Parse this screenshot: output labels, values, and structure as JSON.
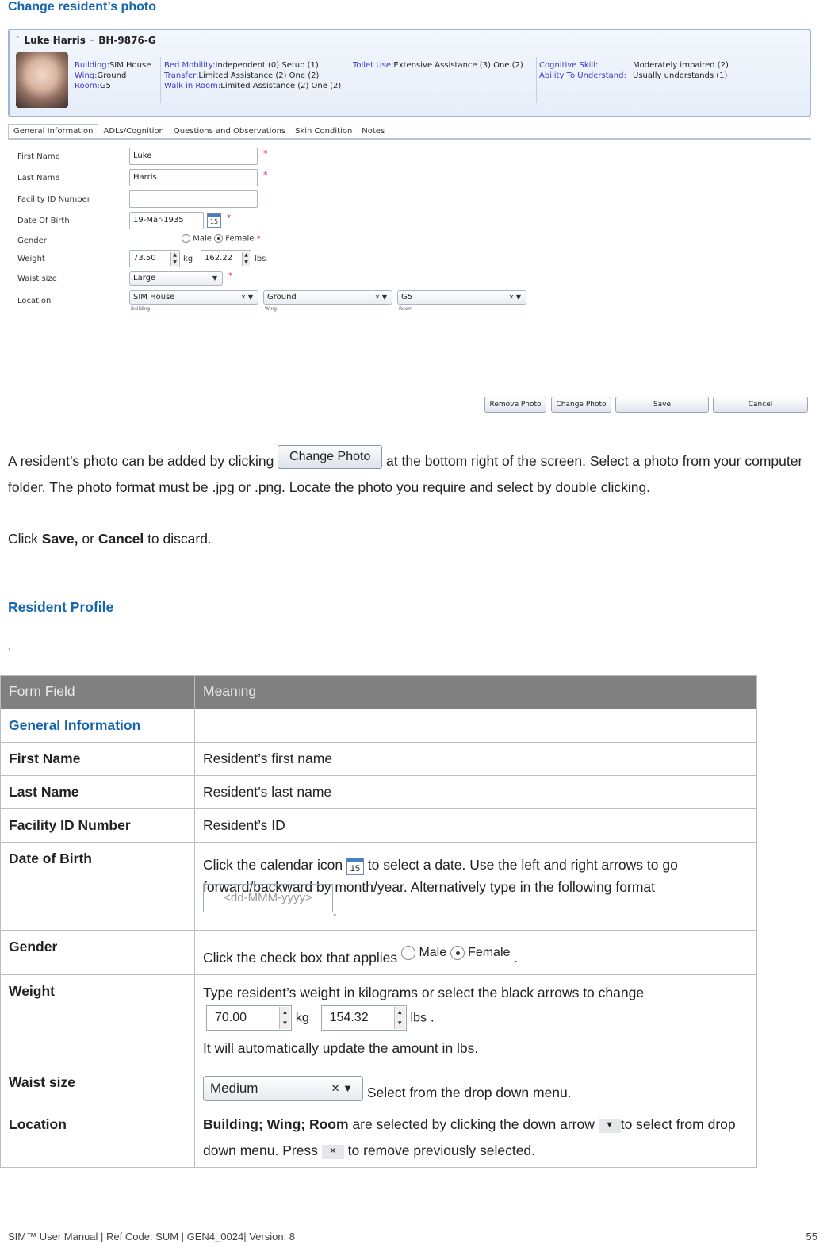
{
  "section_title": "Change resident’s photo",
  "app": {
    "resident_name": "Luke Harris",
    "resident_id": "BH-9876-G",
    "info": {
      "building_label": "Building:",
      "building_value": "SIM House",
      "wing_label": "Wing:",
      "wing_value": "Ground",
      "room_label": "Room:",
      "room_value": "G5",
      "bed_mobility_label": "Bed Mobility:",
      "bed_mobility_value": "Independent (0) Setup (1)",
      "transfer_label": "Transfer:",
      "transfer_value": "Limited Assistance (2) One (2)",
      "walk_label": "Walk in Room:",
      "walk_value": "Limited Assistance (2) One (2)",
      "toilet_label": "Toilet Use:",
      "toilet_value": "Extensive Assistance (3) One (2)",
      "cognitive_label": "Cognitive Skill:",
      "cognitive_value": "Moderately impaired (2)",
      "understand_label": "Ability To Understand:",
      "understand_value": "Usually understands (1)"
    },
    "tabs": [
      "General Information",
      "ADLs/Cognition",
      "Questions and Observations",
      "Skin Condition",
      "Notes"
    ],
    "active_tab": "General Information",
    "form": {
      "first_name_label": "First Name",
      "first_name_value": "Luke",
      "last_name_label": "Last Name",
      "last_name_value": "Harris",
      "facility_id_label": "Facility ID Number",
      "facility_id_value": "",
      "dob_label": "Date Of Birth",
      "dob_value": "19-Mar-1935",
      "calendar_day": "15",
      "gender_label": "Gender",
      "gender_male": "Male",
      "gender_female": "Female",
      "gender_selected": "Female",
      "weight_label": "Weight",
      "weight_kg": "73.50",
      "kg_unit": "kg",
      "weight_lbs": "162.22",
      "lbs_unit": "lbs",
      "waist_label": "Waist size",
      "waist_value": "Large",
      "location_label": "Location",
      "building_value": "SIM House",
      "building_caption": "Building",
      "wing_value": "Ground",
      "wing_caption": "Wing",
      "room_value": "G5",
      "room_caption": "Room",
      "required_mark": "*"
    },
    "buttons": {
      "remove_photo": "Remove Photo",
      "change_photo": "Change Photo",
      "save": "Save",
      "cancel": "Cancel"
    }
  },
  "instructions": {
    "p1_before": "A resident’s photo can be added by clicking ",
    "p1_button": "Change Photo",
    "p1_after": " at the bottom right of the screen. Select a photo from your computer folder. The photo format must be .jpg or .png. Locate the photo you require and select by double clicking.",
    "p2_click": "Click ",
    "p2_save": "Save,",
    "p2_or": " or ",
    "p2_cancel": "Cancel",
    "p2_end": " to discard."
  },
  "profile_heading": "Resident Profile",
  "stray_dot": ".",
  "table": {
    "headers": [
      "Form Field",
      "Meaning"
    ],
    "section": "General Information",
    "rows": [
      {
        "field": "First Name",
        "meaning": "Resident’s first name"
      },
      {
        "field": "Last Name",
        "meaning": "Resident’s last name"
      },
      {
        "field": "Facility ID Number",
        "meaning": "Resident’s ID"
      }
    ],
    "dob": {
      "field": "Date of Birth",
      "t1": "Click the calendar icon ",
      "icon_day": "15",
      "t2": " to select a date. Use the left and right arrows to go forward/backward by month/year. Alternatively type in the following format ",
      "format": "<dd-MMM-yyyy>",
      "t3": "."
    },
    "gender": {
      "field": "Gender",
      "t1": "Click the check box that applies ",
      "male": "Male",
      "female": "Female",
      "t2": "."
    },
    "weight": {
      "field": "Weight",
      "t1": "Type resident’s weight in kilograms or select the black arrows to change",
      "kg": "70.00",
      "kg_unit": "kg",
      "lbs": "154.32",
      "lbs_unit": "lbs",
      "dot": ".",
      "t2": "It will automatically update the amount in lbs."
    },
    "waist": {
      "field": "Waist size",
      "select_value": "Medium",
      "t1": " Select from the drop down menu."
    },
    "location": {
      "field": "Location",
      "bold": "Building; Wing; Room",
      "t1": " are selected by clicking the down arrow ",
      "t2": "to select from drop down menu. Press ",
      "t3": " to remove previously selected."
    }
  },
  "footer": {
    "text": "SIM™ User Manual | Ref Code: SUM | GEN4_0024| Version: 8",
    "page": "55"
  },
  "colors": {
    "heading_blue": "#1565b0",
    "label_blue": "#3a3ad0",
    "table_header_bg": "#808080",
    "required_red": "#e0306a"
  }
}
